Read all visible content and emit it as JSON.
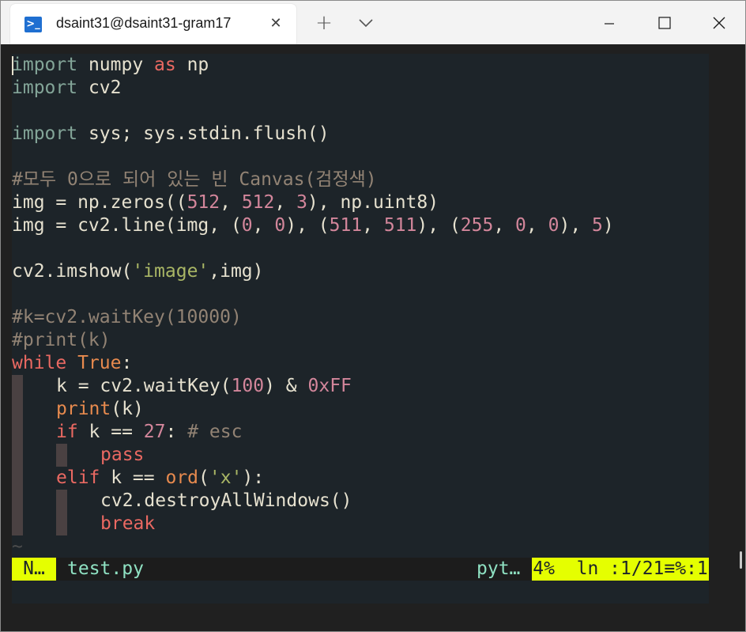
{
  "window": {
    "tab_title": "dsaint31@dsaint31-gram17",
    "tab_icon": "powershell-icon",
    "new_tab_label": "+",
    "close_tab_label": "✕"
  },
  "colors": {
    "background": "#1d2429",
    "accent_statusline": "#e5ff00",
    "keyword_red": "#ea6962",
    "keyword_orange": "#e78a4e",
    "number_pink": "#d3869b",
    "string_green": "#a9b665",
    "comment_gray": "#928374",
    "import_teal": "#83a598"
  },
  "code": {
    "l1": {
      "kw": "import",
      "rest": " numpy ",
      "as": "as",
      "alias": " np"
    },
    "l2": {
      "kw": "import",
      "rest": " cv2"
    },
    "l4": {
      "kw": "import",
      "rest": " sys; sys.stdin.flush()"
    },
    "l6": {
      "comment": "#모두 0으로 되어 있는 빈 Canvas(검정색)"
    },
    "l7": {
      "a": "img = np.zeros((",
      "n1": "512",
      "b": ", ",
      "n2": "512",
      "c": ", ",
      "n3": "3",
      "d": "), np.uint8)"
    },
    "l8": {
      "a": "img = cv2.line(img, (",
      "n1": "0",
      "b": ", ",
      "n2": "0",
      "c": "), (",
      "n3": "511",
      "d": ", ",
      "n4": "511",
      "e": "), (",
      "n5": "255",
      "f": ", ",
      "n6": "0",
      "g": ", ",
      "n7": "0",
      "h": "), ",
      "n8": "5",
      "i": ")"
    },
    "l10": {
      "a": "cv2.imshow(",
      "s": "'image'",
      "b": ",img)"
    },
    "l12": {
      "comment": "#k=cv2.waitKey(10000)"
    },
    "l13": {
      "comment": "#print(k)"
    },
    "l14": {
      "kw": "while",
      "sp": " ",
      "val": "True",
      "rest": ":"
    },
    "l15": {
      "a": "k = cv2.waitKey(",
      "n1": "100",
      "b": ") & ",
      "n2": "0xFF"
    },
    "l16": {
      "fn": "print",
      "rest": "(k)"
    },
    "l17": {
      "kw": "if",
      "a": " k == ",
      "n": "27",
      "b": ": ",
      "comment": "# esc"
    },
    "l18": {
      "kw": "pass"
    },
    "l19": {
      "kw": "elif",
      "a": " k == ",
      "fn": "ord",
      "b": "(",
      "s": "'x'",
      "c": "):"
    },
    "l20": {
      "a": "cv2.destroyAllWindows()"
    },
    "l21": {
      "kw": "break"
    },
    "tilde": "~"
  },
  "statusline": {
    "mode": "N…",
    "filename": "test.py",
    "filetype": "pyt…",
    "position": "4%  ln :1/21≡%:1"
  }
}
